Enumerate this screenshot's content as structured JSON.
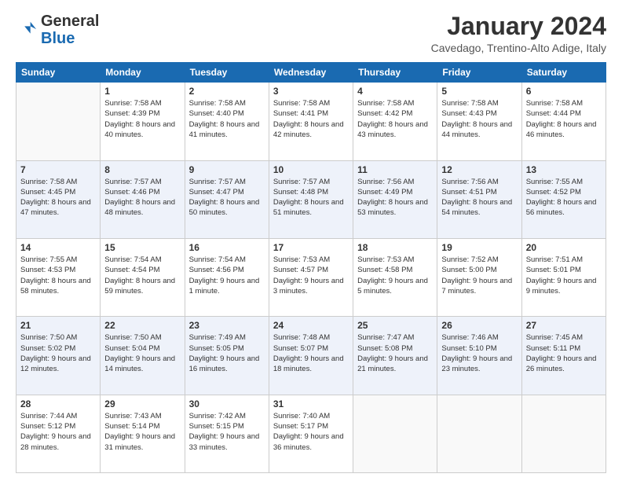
{
  "logo": {
    "general": "General",
    "blue": "Blue"
  },
  "header": {
    "title": "January 2024",
    "location": "Cavedago, Trentino-Alto Adige, Italy"
  },
  "weekdays": [
    "Sunday",
    "Monday",
    "Tuesday",
    "Wednesday",
    "Thursday",
    "Friday",
    "Saturday"
  ],
  "weeks": [
    [
      {
        "day": "",
        "sunrise": "",
        "sunset": "",
        "daylight": "",
        "empty": true
      },
      {
        "day": "1",
        "sunrise": "Sunrise: 7:58 AM",
        "sunset": "Sunset: 4:39 PM",
        "daylight": "Daylight: 8 hours and 40 minutes."
      },
      {
        "day": "2",
        "sunrise": "Sunrise: 7:58 AM",
        "sunset": "Sunset: 4:40 PM",
        "daylight": "Daylight: 8 hours and 41 minutes."
      },
      {
        "day": "3",
        "sunrise": "Sunrise: 7:58 AM",
        "sunset": "Sunset: 4:41 PM",
        "daylight": "Daylight: 8 hours and 42 minutes."
      },
      {
        "day": "4",
        "sunrise": "Sunrise: 7:58 AM",
        "sunset": "Sunset: 4:42 PM",
        "daylight": "Daylight: 8 hours and 43 minutes."
      },
      {
        "day": "5",
        "sunrise": "Sunrise: 7:58 AM",
        "sunset": "Sunset: 4:43 PM",
        "daylight": "Daylight: 8 hours and 44 minutes."
      },
      {
        "day": "6",
        "sunrise": "Sunrise: 7:58 AM",
        "sunset": "Sunset: 4:44 PM",
        "daylight": "Daylight: 8 hours and 46 minutes."
      }
    ],
    [
      {
        "day": "7",
        "sunrise": "Sunrise: 7:58 AM",
        "sunset": "Sunset: 4:45 PM",
        "daylight": "Daylight: 8 hours and 47 minutes."
      },
      {
        "day": "8",
        "sunrise": "Sunrise: 7:57 AM",
        "sunset": "Sunset: 4:46 PM",
        "daylight": "Daylight: 8 hours and 48 minutes."
      },
      {
        "day": "9",
        "sunrise": "Sunrise: 7:57 AM",
        "sunset": "Sunset: 4:47 PM",
        "daylight": "Daylight: 8 hours and 50 minutes."
      },
      {
        "day": "10",
        "sunrise": "Sunrise: 7:57 AM",
        "sunset": "Sunset: 4:48 PM",
        "daylight": "Daylight: 8 hours and 51 minutes."
      },
      {
        "day": "11",
        "sunrise": "Sunrise: 7:56 AM",
        "sunset": "Sunset: 4:49 PM",
        "daylight": "Daylight: 8 hours and 53 minutes."
      },
      {
        "day": "12",
        "sunrise": "Sunrise: 7:56 AM",
        "sunset": "Sunset: 4:51 PM",
        "daylight": "Daylight: 8 hours and 54 minutes."
      },
      {
        "day": "13",
        "sunrise": "Sunrise: 7:55 AM",
        "sunset": "Sunset: 4:52 PM",
        "daylight": "Daylight: 8 hours and 56 minutes."
      }
    ],
    [
      {
        "day": "14",
        "sunrise": "Sunrise: 7:55 AM",
        "sunset": "Sunset: 4:53 PM",
        "daylight": "Daylight: 8 hours and 58 minutes."
      },
      {
        "day": "15",
        "sunrise": "Sunrise: 7:54 AM",
        "sunset": "Sunset: 4:54 PM",
        "daylight": "Daylight: 8 hours and 59 minutes."
      },
      {
        "day": "16",
        "sunrise": "Sunrise: 7:54 AM",
        "sunset": "Sunset: 4:56 PM",
        "daylight": "Daylight: 9 hours and 1 minute."
      },
      {
        "day": "17",
        "sunrise": "Sunrise: 7:53 AM",
        "sunset": "Sunset: 4:57 PM",
        "daylight": "Daylight: 9 hours and 3 minutes."
      },
      {
        "day": "18",
        "sunrise": "Sunrise: 7:53 AM",
        "sunset": "Sunset: 4:58 PM",
        "daylight": "Daylight: 9 hours and 5 minutes."
      },
      {
        "day": "19",
        "sunrise": "Sunrise: 7:52 AM",
        "sunset": "Sunset: 5:00 PM",
        "daylight": "Daylight: 9 hours and 7 minutes."
      },
      {
        "day": "20",
        "sunrise": "Sunrise: 7:51 AM",
        "sunset": "Sunset: 5:01 PM",
        "daylight": "Daylight: 9 hours and 9 minutes."
      }
    ],
    [
      {
        "day": "21",
        "sunrise": "Sunrise: 7:50 AM",
        "sunset": "Sunset: 5:02 PM",
        "daylight": "Daylight: 9 hours and 12 minutes."
      },
      {
        "day": "22",
        "sunrise": "Sunrise: 7:50 AM",
        "sunset": "Sunset: 5:04 PM",
        "daylight": "Daylight: 9 hours and 14 minutes."
      },
      {
        "day": "23",
        "sunrise": "Sunrise: 7:49 AM",
        "sunset": "Sunset: 5:05 PM",
        "daylight": "Daylight: 9 hours and 16 minutes."
      },
      {
        "day": "24",
        "sunrise": "Sunrise: 7:48 AM",
        "sunset": "Sunset: 5:07 PM",
        "daylight": "Daylight: 9 hours and 18 minutes."
      },
      {
        "day": "25",
        "sunrise": "Sunrise: 7:47 AM",
        "sunset": "Sunset: 5:08 PM",
        "daylight": "Daylight: 9 hours and 21 minutes."
      },
      {
        "day": "26",
        "sunrise": "Sunrise: 7:46 AM",
        "sunset": "Sunset: 5:10 PM",
        "daylight": "Daylight: 9 hours and 23 minutes."
      },
      {
        "day": "27",
        "sunrise": "Sunrise: 7:45 AM",
        "sunset": "Sunset: 5:11 PM",
        "daylight": "Daylight: 9 hours and 26 minutes."
      }
    ],
    [
      {
        "day": "28",
        "sunrise": "Sunrise: 7:44 AM",
        "sunset": "Sunset: 5:12 PM",
        "daylight": "Daylight: 9 hours and 28 minutes."
      },
      {
        "day": "29",
        "sunrise": "Sunrise: 7:43 AM",
        "sunset": "Sunset: 5:14 PM",
        "daylight": "Daylight: 9 hours and 31 minutes."
      },
      {
        "day": "30",
        "sunrise": "Sunrise: 7:42 AM",
        "sunset": "Sunset: 5:15 PM",
        "daylight": "Daylight: 9 hours and 33 minutes."
      },
      {
        "day": "31",
        "sunrise": "Sunrise: 7:40 AM",
        "sunset": "Sunset: 5:17 PM",
        "daylight": "Daylight: 9 hours and 36 minutes."
      },
      {
        "day": "",
        "sunrise": "",
        "sunset": "",
        "daylight": "",
        "empty": true
      },
      {
        "day": "",
        "sunrise": "",
        "sunset": "",
        "daylight": "",
        "empty": true
      },
      {
        "day": "",
        "sunrise": "",
        "sunset": "",
        "daylight": "",
        "empty": true
      }
    ]
  ],
  "row_styles": [
    "row-white",
    "row-alt",
    "row-white",
    "row-alt",
    "row-white"
  ]
}
